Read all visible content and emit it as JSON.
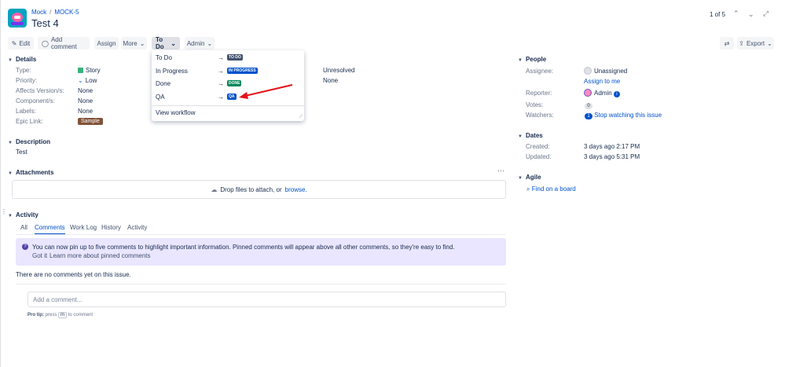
{
  "header": {
    "project": "Mock",
    "issue_key": "MOCK-5",
    "title": "Test 4",
    "pager": "1 of 5"
  },
  "toolbar": {
    "edit": "Edit",
    "add_comment": "Add comment",
    "assign": "Assign",
    "more": "More",
    "status": "To Do",
    "admin": "Admin",
    "export": "Export"
  },
  "details": {
    "heading": "Details",
    "fields": [
      {
        "label": "Type:",
        "value": "Story"
      },
      {
        "label": "Priority:",
        "value": "Low"
      },
      {
        "label": "Affects Version/s:",
        "value": "None"
      },
      {
        "label": "Component/s:",
        "value": "None"
      },
      {
        "label": "Labels:",
        "value": "None"
      },
      {
        "label": "Epic Link:",
        "value": "Sample"
      }
    ],
    "resolution": "Unresolved",
    "fix_versions": "None"
  },
  "transitions": {
    "items": [
      {
        "label": "To Do",
        "lozenge": "TO DO",
        "color": "#42526e"
      },
      {
        "label": "In Progress",
        "lozenge": "IN PROGRESS",
        "color": "#0052cc"
      },
      {
        "label": "Done",
        "lozenge": "DONE",
        "color": "#00875a"
      },
      {
        "label": "QA",
        "lozenge": "QA",
        "color": "#0052cc"
      }
    ],
    "workflow": "View workflow"
  },
  "description": {
    "heading": "Description",
    "text": "Test"
  },
  "attachments": {
    "heading": "Attachments",
    "drop_text": "Drop files to attach, or",
    "browse": "browse."
  },
  "activity": {
    "heading": "Activity",
    "tabs": [
      "All",
      "Comments",
      "Work Log",
      "History",
      "Activity"
    ],
    "info": "You can now pin up to five comments to highlight important information. Pinned comments will appear above all other comments, so they're easy to find.",
    "got_it": "Got it",
    "learn_more": "Learn more about pinned comments",
    "no_comments": "There are no comments yet on this issue.",
    "comment_placeholder": "Add a comment...",
    "pro_tip_label": "Pro tip:",
    "pro_tip_press": "press",
    "pro_tip_key": "m",
    "pro_tip_rest": "to comment"
  },
  "people": {
    "heading": "People",
    "assignee_label": "Assignee:",
    "assignee": "Unassigned",
    "assign_to_me": "Assign to me",
    "reporter_label": "Reporter:",
    "reporter": "Admin",
    "votes_label": "Votes:",
    "votes": "0",
    "watchers_label": "Watchers:",
    "watchers": "1",
    "stop_watching": "Stop watching this issue"
  },
  "dates": {
    "heading": "Dates",
    "created_label": "Created:",
    "created": "3 days ago 2:17 PM",
    "updated_label": "Updated:",
    "updated": "3 days ago 5:31 PM"
  },
  "agile": {
    "heading": "Agile",
    "find_board": "Find on a board"
  }
}
